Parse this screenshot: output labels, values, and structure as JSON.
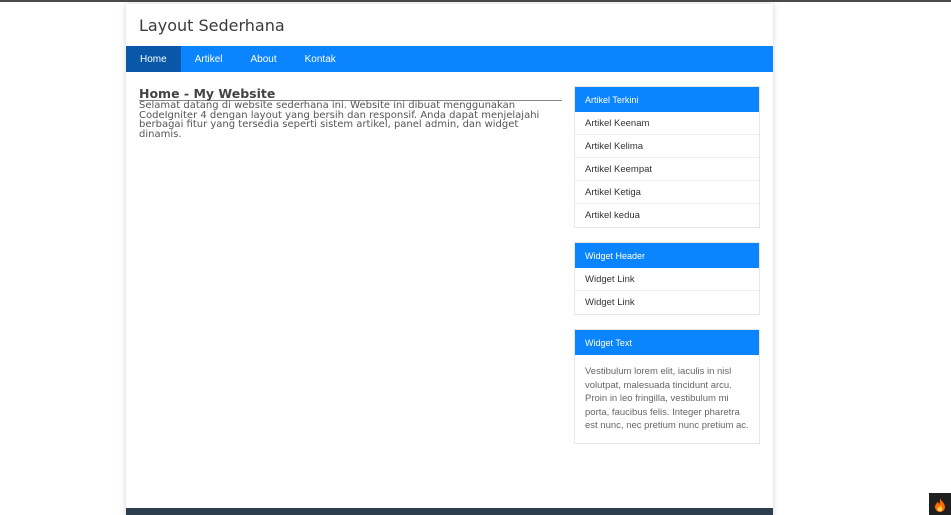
{
  "site": {
    "title": "Layout Sederhana"
  },
  "nav": {
    "items": [
      {
        "label": "Home",
        "active": true
      },
      {
        "label": "Artikel"
      },
      {
        "label": "About"
      },
      {
        "label": "Kontak"
      }
    ]
  },
  "main": {
    "heading": "Home - My Website",
    "paragraph": "Selamat datang di website sederhana ini. Website ini dibuat menggunakan CodeIgniter 4 dengan layout yang bersih dan responsif. Anda dapat menjelajahi berbagai fitur yang tersedia seperti sistem artikel, panel admin, dan widget dinamis."
  },
  "sidebar": {
    "recent": {
      "title": "Artikel Terkini",
      "items": [
        "Artikel Keenam",
        "Artikel Kelima",
        "Artikel Keempat",
        "Artikel Ketiga",
        "Artikel kedua"
      ]
    },
    "widget_links": {
      "title": "Widget Header",
      "items": [
        "Widget Link",
        "Widget Link"
      ]
    },
    "widget_text": {
      "title": "Widget Text",
      "body": "Vestibulum lorem elit, iaculis in nisl volutpat, malesuada tincidunt arcu. Proin in leo fringilla, vestibulum mi porta, faucibus felis. Integer pharetra est nunc, nec pretium nunc pretium ac."
    }
  },
  "colors": {
    "accent": "#0a84ff",
    "nav_active": "#0857a8",
    "footer": "#2c3e50"
  },
  "icons": {
    "debug_toolbar": "flame-icon"
  }
}
